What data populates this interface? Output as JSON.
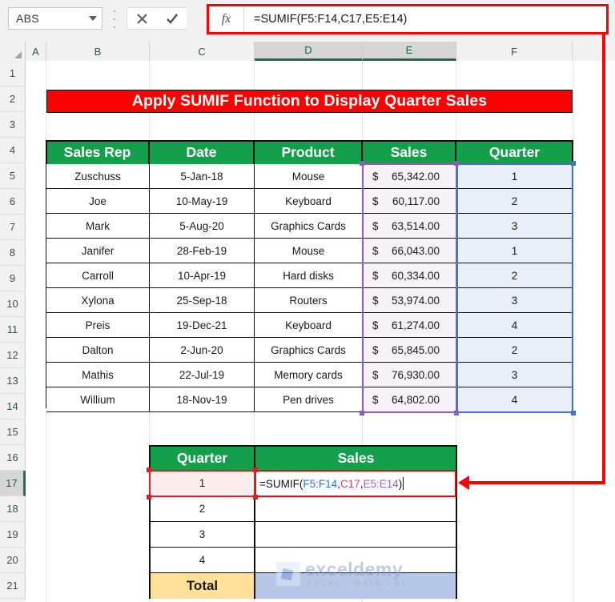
{
  "formula_bar": {
    "name_box_value": "ABS",
    "cancel_icon": "close-icon",
    "confirm_icon": "check-icon",
    "fx_label": "fx",
    "formula": "=SUMIF(F5:F14,C17,E5:E14)"
  },
  "grid": {
    "columns": [
      "A",
      "B",
      "C",
      "D",
      "E",
      "F"
    ],
    "active_columns": [
      "D",
      "E"
    ],
    "rows": [
      "1",
      "2",
      "3",
      "4",
      "5",
      "6",
      "7",
      "8",
      "9",
      "10",
      "11",
      "12",
      "13",
      "14",
      "15",
      "16",
      "17",
      "18",
      "19",
      "20",
      "21"
    ],
    "active_row": "17"
  },
  "title": {
    "text": "Apply SUMIF Function to Display Quarter Sales",
    "background": "#ff0000",
    "color": "#ffffff"
  },
  "main_table": {
    "headers": [
      "Sales Rep",
      "Date",
      "Product",
      "Sales",
      "Quarter"
    ],
    "header_background": "#14a04a",
    "rows": [
      {
        "rep": "Zuschuss",
        "date": "5-Jan-18",
        "product": "Mouse",
        "currency": "$",
        "sales": "65,342.00",
        "quarter": "1"
      },
      {
        "rep": "Joe",
        "date": "10-May-19",
        "product": "Keyboard",
        "currency": "$",
        "sales": "60,117.00",
        "quarter": "2"
      },
      {
        "rep": "Mark",
        "date": "5-Aug-20",
        "product": "Graphics Cards",
        "currency": "$",
        "sales": "63,514.00",
        "quarter": "3"
      },
      {
        "rep": "Janifer",
        "date": "28-Feb-19",
        "product": "Mouse",
        "currency": "$",
        "sales": "66,043.00",
        "quarter": "1"
      },
      {
        "rep": "Carroll",
        "date": "10-Apr-19",
        "product": "Hard disks",
        "currency": "$",
        "sales": "60,334.00",
        "quarter": "2"
      },
      {
        "rep": "Xylona",
        "date": "25-Sep-18",
        "product": "Routers",
        "currency": "$",
        "sales": "53,974.00",
        "quarter": "3"
      },
      {
        "rep": "Preis",
        "date": "19-Dec-21",
        "product": "Keyboard",
        "currency": "$",
        "sales": "61,274.00",
        "quarter": "4"
      },
      {
        "rep": "Dalton",
        "date": "2-Jun-20",
        "product": "Graphics Cards",
        "currency": "$",
        "sales": "65,845.00",
        "quarter": "2"
      },
      {
        "rep": "Mathis",
        "date": "22-Jul-19",
        "product": "Memory cards",
        "currency": "$",
        "sales": "76,930.00",
        "quarter": "3"
      },
      {
        "rep": "Willium",
        "date": "18-Nov-19",
        "product": "Pen drives",
        "currency": "$",
        "sales": "64,802.00",
        "quarter": "4"
      }
    ],
    "selection": {
      "sales_range_color": "#8a5cc4",
      "quarter_range_color": "#3f72c9"
    }
  },
  "summary_table": {
    "headers": [
      "Quarter",
      "Sales"
    ],
    "header_background": "#14a04a",
    "rows": [
      {
        "quarter": "1",
        "sales": ""
      },
      {
        "quarter": "2",
        "sales": ""
      },
      {
        "quarter": "3",
        "sales": ""
      },
      {
        "quarter": "4",
        "sales": ""
      }
    ],
    "total_label": "Total",
    "total_value": "",
    "active_cell_formula": {
      "prefix": "=SUMIF(",
      "arg1": "F5:F14",
      "sep1": ",",
      "arg2": "C17",
      "sep2": ",",
      "arg3": "E5:E14",
      "suffix": ")"
    }
  },
  "annotation": {
    "color": "#ff0000",
    "description": "arrow-from-formula-bar-to-cell"
  },
  "watermark": {
    "name": "exceldemy",
    "tagline": "EXCEL · DATA · BI"
  }
}
